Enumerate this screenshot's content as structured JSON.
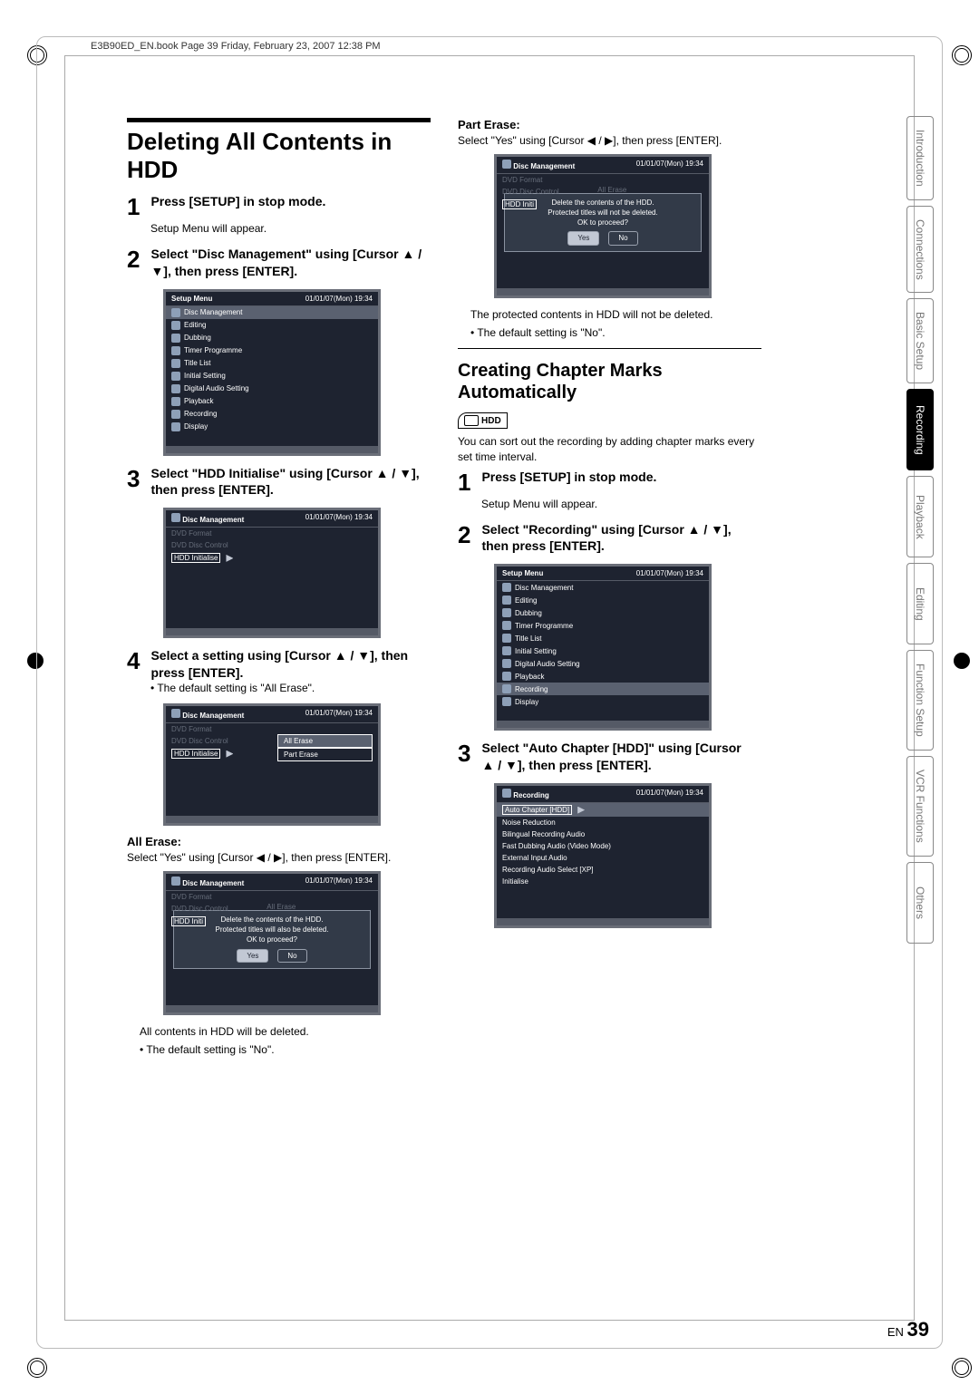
{
  "bookmark": "E3B90ED_EN.book  Page 39  Friday, February 23, 2007  12:38 PM",
  "left": {
    "title": "Deleting All Contents in HDD",
    "s1_head": "Press [SETUP] in stop mode.",
    "s1_sub": "Setup Menu will appear.",
    "s2_head": "Select \"Disc Management\" using [Cursor ▲ / ▼], then press [ENTER].",
    "s3_head": "Select \"HDD Initialise\" using [Cursor ▲ / ▼], then press [ENTER].",
    "s4_head": "Select a setting using [Cursor ▲ / ▼], then press [ENTER].",
    "s4_bullet": "• The default setting is \"All Erase\".",
    "all_erase_head": "All Erase:",
    "all_erase_txt": "Select \"Yes\" using [Cursor ◀ / ▶], then press [ENTER].",
    "all_erase_note1": "All contents in HDD will be deleted.",
    "all_erase_note2": "• The default setting is \"No\"."
  },
  "right": {
    "part_erase_head": "Part Erase:",
    "part_erase_txt": "Select \"Yes\" using [Cursor ◀ / ▶], then press [ENTER].",
    "part_note1": "The protected contents in HDD will not be deleted.",
    "part_note2": "• The default setting is \"No\".",
    "section_title": "Creating Chapter Marks Automatically",
    "hdd_icon": "HDD",
    "intro": "You can sort out the recording by adding chapter marks every set time interval.",
    "s1_head": "Press [SETUP] in stop mode.",
    "s1_sub": "Setup Menu will appear.",
    "s2_head": "Select \"Recording\" using [Cursor ▲ / ▼], then press [ENTER].",
    "s3_head": "Select \"Auto Chapter [HDD]\" using [Cursor ▲ / ▼], then press [ENTER]."
  },
  "panels": {
    "datetime": "01/01/07(Mon)    19:34",
    "setup_title": "Setup Menu",
    "setup_items": [
      "Disc Management",
      "Editing",
      "Dubbing",
      "Timer Programme",
      "Title List",
      "Initial Setting",
      "Digital Audio Setting",
      "Playback",
      "Recording",
      "Display"
    ],
    "dm_title": "Disc Management",
    "dm_items": [
      "DVD Format",
      "DVD Disc Control",
      "HDD Initialise"
    ],
    "dm_opts": [
      "All Erase",
      "Part Erase"
    ],
    "dialog1": [
      "Delete the contents of the HDD.",
      "Protected titles will also be deleted.",
      "OK to proceed?"
    ],
    "dialog2": [
      "Delete the contents of the HDD.",
      "Protected titles will not be deleted.",
      "OK to proceed?"
    ],
    "yes": "Yes",
    "no": "No",
    "rec_title": "Recording",
    "rec_items": [
      "Auto Chapter [HDD]",
      "Noise Reduction",
      "Bilingual Recording Audio",
      "Fast Dubbing Audio (Video Mode)",
      "External Input Audio",
      "Recording Audio Select [XP]",
      "Initialise"
    ]
  },
  "tabs": [
    "Introduction",
    "Connections",
    "Basic Setup",
    "Recording",
    "Playback",
    "Editing",
    "Function Setup",
    "VCR Functions",
    "Others"
  ],
  "page_en": "EN",
  "page_num": "39"
}
